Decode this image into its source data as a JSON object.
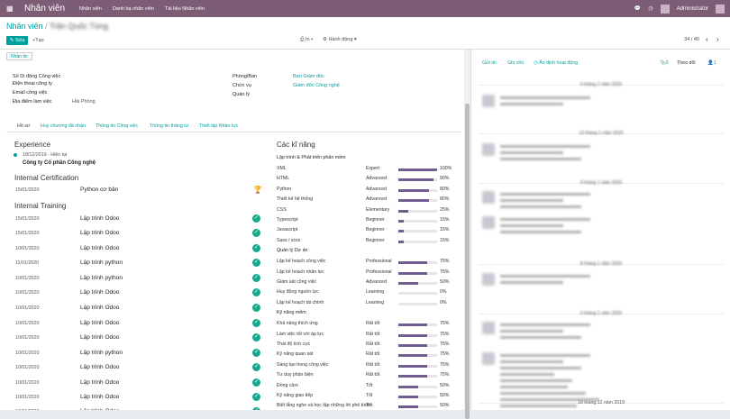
{
  "topbar": {
    "app_title": "Nhân viên",
    "menus": [
      "Nhân viên",
      "Danh bạ nhân viên",
      "Tài liệu Nhân viên"
    ],
    "user": "Administrator",
    "bg_color": "#7c5d75"
  },
  "breadcrumb": {
    "parent": "Nhân viên",
    "separator": "/",
    "current": "Trần Quốc Tùng"
  },
  "actions": {
    "edit": "Sửa",
    "create": "Tạo",
    "print": "In",
    "action": "Hành động"
  },
  "pager": {
    "value": "34 / 40"
  },
  "form": {
    "tag": "Nhân tin",
    "fields_left": [
      {
        "label": "Số Di động Công việc",
        "value": ""
      },
      {
        "label": "Điện thoại công ty",
        "value": ""
      },
      {
        "label": "Email công việc",
        "value": ""
      },
      {
        "label": "Địa điểm làm việc",
        "value": "Hải Phòng"
      }
    ],
    "fields_right": [
      {
        "label": "Phòng/Ban",
        "value": "Ban Giám đốc"
      },
      {
        "label": "Chức vụ",
        "value": "Giám đốc Công nghệ"
      },
      {
        "label": "Quản lý",
        "value": ""
      }
    ],
    "tabs": [
      "Hồ sơ",
      "Huy chương đã nhận",
      "Thông tin Công việc",
      "Thông tin thăng tư",
      "Thiết lập Nhân lực"
    ]
  },
  "resume": {
    "experience_title": "Experience",
    "experience": {
      "date": "18/12/2019 - Hiện tại",
      "company": "Công ty Cổ phần Công nghệ"
    },
    "cert_title": "Internal Certification",
    "cert": {
      "date": "15/01/2020",
      "name": "Python cơ bản"
    },
    "training_title": "Internal Training",
    "training": [
      {
        "date": "15/01/2020",
        "name": "Lập trình Odoo"
      },
      {
        "date": "15/01/2020",
        "name": "Lập trình Odoo"
      },
      {
        "date": "10/01/2020",
        "name": "Lập trình Odoo"
      },
      {
        "date": "11/01/2020",
        "name": "Lập trình python"
      },
      {
        "date": "10/01/2020",
        "name": "Lập trình python"
      },
      {
        "date": "10/01/2020",
        "name": "Lập trình Odoo"
      },
      {
        "date": "10/01/2020",
        "name": "Lập trình Odoo"
      },
      {
        "date": "10/01/2020",
        "name": "Lập trình Odoo"
      },
      {
        "date": "10/01/2020",
        "name": "Lập trình Odoo"
      },
      {
        "date": "10/01/2020",
        "name": "Lập trình python"
      },
      {
        "date": "10/01/2020",
        "name": "Lập trình Odoo"
      },
      {
        "date": "10/01/2020",
        "name": "Lập trình Odoo"
      },
      {
        "date": "10/01/2020",
        "name": "Lập trình Odoo"
      },
      {
        "date": "10/01/2020",
        "name": "Lập trình Odoo"
      }
    ]
  },
  "skills": {
    "title": "Các kĩ năng",
    "groups": [
      {
        "name": "Lập trình & Phát triển phần mềm",
        "items": [
          {
            "name": "XML",
            "level": "Expert",
            "pct": 100
          },
          {
            "name": "HTML",
            "level": "Advanced",
            "pct": 90
          },
          {
            "name": "Python",
            "level": "Advanced",
            "pct": 80
          },
          {
            "name": "Thiết kế hệ thống",
            "level": "Advanced",
            "pct": 80
          },
          {
            "name": "CSS",
            "level": "Elementary",
            "pct": 25
          },
          {
            "name": "Typescript",
            "level": "Beginner",
            "pct": 15
          },
          {
            "name": "Javascript",
            "level": "Beginner",
            "pct": 15
          },
          {
            "name": "Sass / scss",
            "level": "Beginner",
            "pct": 15
          }
        ]
      },
      {
        "name": "Quản lý Dự án",
        "items": [
          {
            "name": "Lập kế hoạch công việc",
            "level": "Professional",
            "pct": 75
          },
          {
            "name": "Lập kế hoạch nhân lực",
            "level": "Professional",
            "pct": 75
          },
          {
            "name": "Giám sát công việc",
            "level": "Advanced",
            "pct": 50
          },
          {
            "name": "Huy động nguồn lực",
            "level": "Learning",
            "pct": 0
          },
          {
            "name": "Lập kế hoạch tài chính",
            "level": "Learning",
            "pct": 0
          }
        ]
      },
      {
        "name": "Kỹ năng mềm",
        "items": [
          {
            "name": "Khả năng thích ứng",
            "level": "Rất tốt",
            "pct": 75
          },
          {
            "name": "Làm việc tốt với áp lực",
            "level": "Rất tốt",
            "pct": 75
          },
          {
            "name": "Thái độ tích cực",
            "level": "Rất tốt",
            "pct": 75
          },
          {
            "name": "Kỹ năng quan sát",
            "level": "Rất tốt",
            "pct": 75
          },
          {
            "name": "Sáng tạo trong công việc",
            "level": "Rất tốt",
            "pct": 75
          },
          {
            "name": "Tư duy phản biện",
            "level": "Rất tốt",
            "pct": 75
          },
          {
            "name": "Đồng cảm",
            "level": "Tốt",
            "pct": 50
          },
          {
            "name": "Kỹ năng giao tiếp",
            "level": "Tốt",
            "pct": 50
          },
          {
            "name": "Biết lắng nghe và học tập những lời phê bình",
            "level": "Tốt",
            "pct": 50
          }
        ]
      }
    ]
  },
  "chatter": {
    "send": "Gửi tin",
    "note": "Ghi chú",
    "schedule": "Ấn định hoạt động",
    "attachments": "0",
    "follow": "Theo dõi",
    "followers": "1",
    "dates": [
      "6 tháng 2 năm 2020",
      "13 tháng 1 năm 2020",
      "8 tháng 1 năm 2020",
      "8 tháng 1 năm 2020",
      "6 tháng 1 năm 2020",
      "18 tháng 12 năm 2019"
    ]
  }
}
